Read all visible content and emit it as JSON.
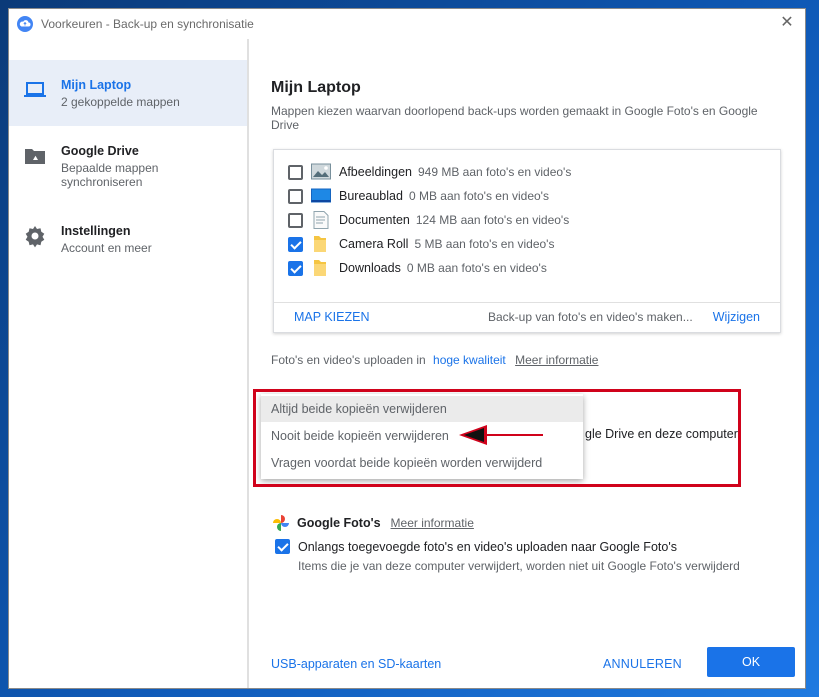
{
  "window": {
    "title": "Voorkeuren - Back-up en synchronisatie"
  },
  "sidebar": {
    "items": [
      {
        "title": "Mijn Laptop",
        "subtitle": "2 gekoppelde mappen"
      },
      {
        "title": "Google Drive",
        "subtitle": "Bepaalde mappen synchroniseren"
      },
      {
        "title": "Instellingen",
        "subtitle": "Account en meer"
      }
    ]
  },
  "main": {
    "title": "Mijn Laptop",
    "description": "Mappen kiezen waarvan doorlopend back-ups worden gemaakt in Google Foto's en Google Drive",
    "folders": [
      {
        "name": "Afbeeldingen",
        "size": "949 MB aan foto's en video's",
        "checked": false,
        "icon": "pictures-icon"
      },
      {
        "name": "Bureaublad",
        "size": "0 MB aan foto's en video's",
        "checked": false,
        "icon": "desktop-icon"
      },
      {
        "name": "Documenten",
        "size": "124 MB aan foto's en video's",
        "checked": false,
        "icon": "documents-icon"
      },
      {
        "name": "Camera Roll",
        "size": "5 MB aan foto's en video's",
        "checked": true,
        "icon": "folder-icon"
      },
      {
        "name": "Downloads",
        "size": "0 MB aan foto's en video's",
        "checked": true,
        "icon": "folder-icon"
      }
    ],
    "choose_folder": "MAP KIEZEN",
    "backup_status": "Back-up van foto's en video's maken...",
    "change": "Wijzigen",
    "upload_prefix": "Foto's en video's uploaden in",
    "upload_quality": "hoge kwaliteit",
    "more_info": "Meer informatie",
    "behind_dropdown_text": "gle Drive en deze computer",
    "dropdown_options": [
      "Altijd beide kopieën verwijderen",
      "Nooit beide kopieën verwijderen",
      "Vragen voordat beide kopieën worden verwijderd"
    ],
    "google_photos": {
      "title": "Google Foto's",
      "more_info": "Meer informatie",
      "checkbox_label": "Onlangs toegevoegde foto's en video's uploaden naar Google Foto's",
      "note": "Items die je van deze computer verwijdert, worden niet uit Google Foto's verwijderd"
    }
  },
  "footer": {
    "usb_link": "USB-apparaten en SD-kaarten",
    "cancel": "ANNULEREN",
    "ok": "OK"
  },
  "colors": {
    "accent": "#1a73e8",
    "highlight_box": "#d0021b"
  }
}
